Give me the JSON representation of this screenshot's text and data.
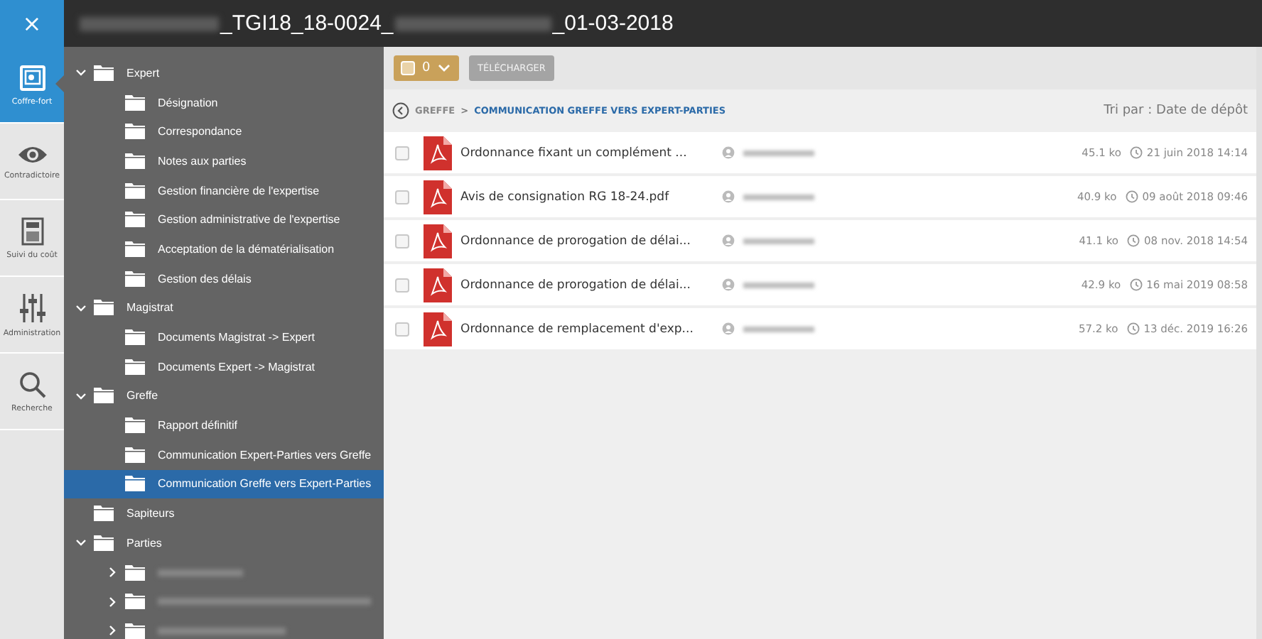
{
  "close_button": {
    "label": "×"
  },
  "title_parts": [
    {
      "kind": "redacted"
    },
    {
      "kind": "text",
      "text": "_TGI18_18-0024_"
    },
    {
      "kind": "redacted"
    },
    {
      "kind": "text",
      "text": "_01-03-2018"
    }
  ],
  "rail": [
    {
      "label": "Coffre-fort",
      "selected": true
    },
    {
      "label": "Contradictoire",
      "selected": false
    },
    {
      "label": "Suivi du coût",
      "selected": false
    },
    {
      "label": "Administration",
      "selected": false
    },
    {
      "label": "Recherche",
      "selected": false
    }
  ],
  "tree": [
    {
      "label": "Expert",
      "expanded": true,
      "selected": false,
      "children": [
        {
          "label": "Désignation",
          "selected": false
        },
        {
          "label": "Correspondance",
          "selected": false
        },
        {
          "label": "Notes aux parties",
          "selected": false
        },
        {
          "label": "Gestion financière de l'expertise",
          "selected": false
        },
        {
          "label": "Gestion administrative de l'expertise",
          "selected": false
        },
        {
          "label": "Acceptation de la dématérialisation",
          "selected": false
        },
        {
          "label": "Gestion des délais",
          "selected": false
        }
      ]
    },
    {
      "label": "Magistrat",
      "expanded": true,
      "selected": false,
      "children": [
        {
          "label": "Documents Magistrat -> Expert",
          "selected": false
        },
        {
          "label": "Documents Expert -> Magistrat",
          "selected": false
        }
      ]
    },
    {
      "label": "Greffe",
      "expanded": true,
      "selected": false,
      "children": [
        {
          "label": "Rapport définitif",
          "selected": false
        },
        {
          "label": "Communication Expert-Parties vers Greffe",
          "selected": false
        },
        {
          "label": "Communication Greffe vers Expert-Parties",
          "selected": true
        }
      ]
    },
    {
      "label": "Sapiteurs",
      "selected": false
    },
    {
      "label": "Parties",
      "expanded": true,
      "selected": false,
      "children": [
        {
          "kind": "redacted",
          "expanded": false,
          "selected": false
        },
        {
          "kind": "redacted",
          "expanded": false,
          "selected": false
        },
        {
          "kind": "redacted",
          "expanded": false,
          "selected": false
        }
      ]
    }
  ],
  "toolbar": {
    "select_all": {
      "checked": false,
      "count": "0"
    },
    "download_button": "TÉLÉCHARGER"
  },
  "breadcrumb": {
    "items": [
      {
        "label": "GREFFE",
        "current": false
      },
      {
        "label": "COMMUNICATION GREFFE VERS EXPERT-PARTIES",
        "current": true
      }
    ],
    "separator": ">"
  },
  "sort_label": "Tri par : Date de dépôt",
  "files": [
    {
      "name": "Ordonnance fixant un complément ...",
      "checked": false,
      "size": "45.1 ko",
      "date": "21 juin 2018 14:14"
    },
    {
      "name": "Avis de consignation RG 18-24.pdf",
      "checked": false,
      "size": "40.9 ko",
      "date": "09 août 2018 09:46"
    },
    {
      "name": "Ordonnance de prorogation de délai...",
      "checked": false,
      "size": "41.1 ko",
      "date": "08 nov. 2018 14:54"
    },
    {
      "name": "Ordonnance de prorogation de délai...",
      "checked": false,
      "size": "42.9 ko",
      "date": "16 mai 2019 08:58"
    },
    {
      "name": "Ordonnance de remplacement d'exp...",
      "checked": false,
      "size": "57.2 ko",
      "date": "13 déc. 2019 16:26"
    }
  ]
}
